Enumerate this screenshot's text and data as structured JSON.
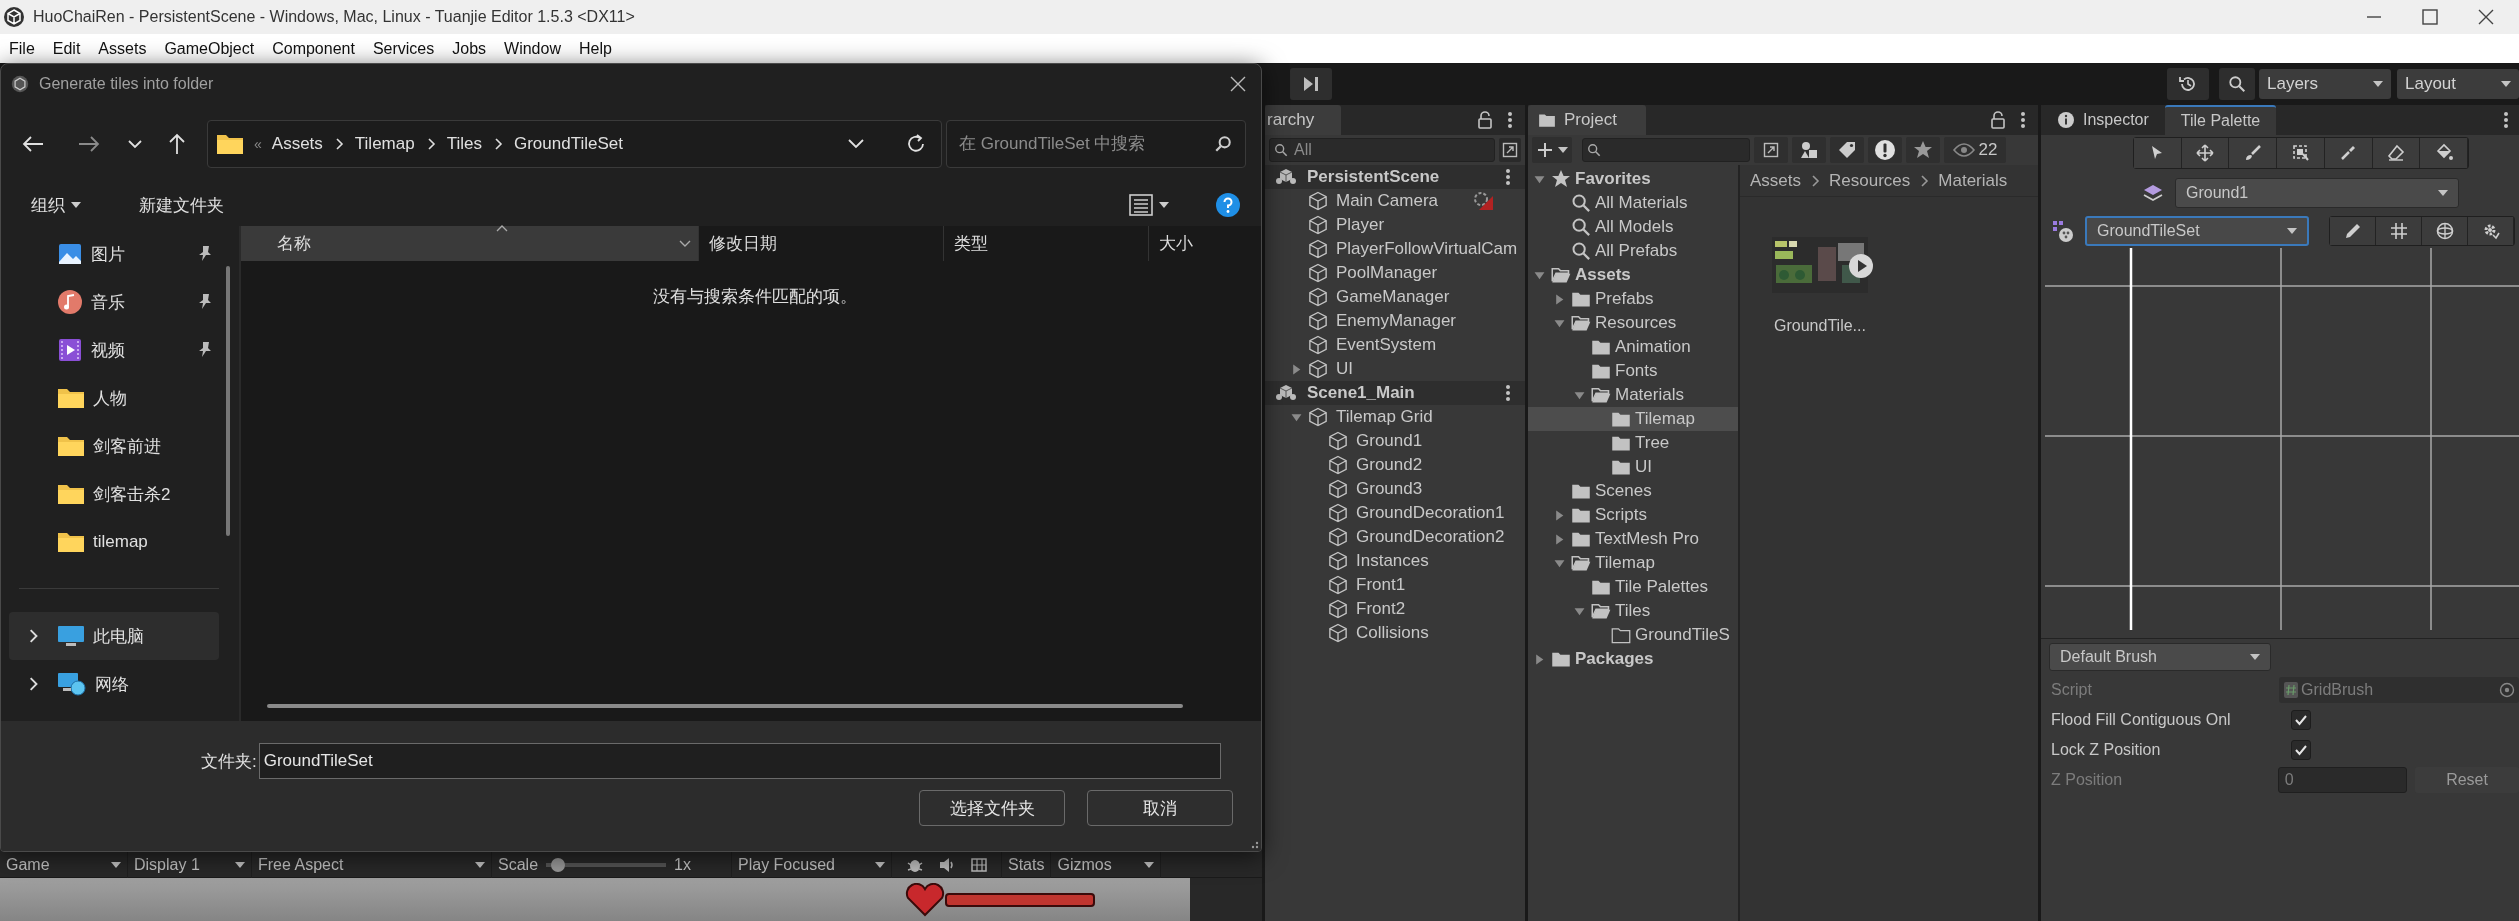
{
  "title_bar": {
    "title": "HuoChaiRen - PersistentScene - Windows, Mac, Linux - Tuanjie Editor 1.5.3 <DX11>"
  },
  "menu_bar": [
    "File",
    "Edit",
    "Assets",
    "GameObject",
    "Component",
    "Services",
    "Jobs",
    "Window",
    "Help"
  ],
  "toolbar": {
    "layers": "Layers",
    "layout": "Layout"
  },
  "dialog": {
    "title": "Generate tiles into folder",
    "overflow_mark": "«",
    "path": [
      "Assets",
      "Tilemap",
      "Tiles",
      "GroundTileSet"
    ],
    "search_placeholder": "在 GroundTileSet 中搜索",
    "commands": [
      "组织",
      "新建文件夹"
    ],
    "nav_items": [
      {
        "label": "图片",
        "kind": "pictures",
        "pinned": true,
        "selected": false
      },
      {
        "label": "音乐",
        "kind": "music",
        "pinned": true,
        "selected": false
      },
      {
        "label": "视频",
        "kind": "videos",
        "pinned": true,
        "selected": false
      },
      {
        "label": "人物",
        "kind": "folder",
        "pinned": false,
        "selected": false
      },
      {
        "label": "剑客前进",
        "kind": "folder",
        "pinned": false,
        "selected": false
      },
      {
        "label": "剑客击杀2",
        "kind": "folder",
        "pinned": false,
        "selected": false
      },
      {
        "label": "tilemap",
        "kind": "folder",
        "pinned": false,
        "selected": false
      },
      {
        "label": "此电脑",
        "kind": "computer",
        "pinned": false,
        "selected": true,
        "expanded": false
      },
      {
        "label": "网络",
        "kind": "network",
        "pinned": false,
        "selected": false,
        "expanded": false
      }
    ],
    "columns": [
      "名称",
      "修改日期",
      "类型",
      "大小"
    ],
    "empty_message": "没有与搜索条件匹配的项。",
    "folder_label": "文件夹:",
    "folder_value": "GroundTileSet",
    "buttons": [
      "选择文件夹",
      "取消"
    ]
  },
  "game_bar": {
    "tab": "Game",
    "display": "Display 1",
    "aspect": "Free Aspect",
    "scale_label": "Scale",
    "scale": {
      "level": 0.05
    },
    "scale_value": "1x",
    "play_mode": "Play Focused",
    "stats": "Stats",
    "gizmos": "Gizmos"
  },
  "hierarchy": {
    "tab": "rarchy",
    "search_placeholder": "All",
    "scenes": [
      {
        "name": "PersistentScene",
        "children": [
          {
            "name": "Main Camera",
            "kind": "camera"
          },
          {
            "name": "Player",
            "kind": "object"
          },
          {
            "name": "PlayerFollowVirtualCam",
            "kind": "object"
          },
          {
            "name": "PoolManager",
            "kind": "object"
          },
          {
            "name": "GameManager",
            "kind": "object"
          },
          {
            "name": "EnemyManager",
            "kind": "object"
          },
          {
            "name": "EventSystem",
            "kind": "object"
          },
          {
            "name": "UI",
            "kind": "object",
            "expanded": false
          }
        ]
      },
      {
        "name": "Scene1_Main",
        "children": [
          {
            "name": "Tilemap Grid",
            "kind": "object",
            "expanded": true,
            "children": [
              {
                "name": "Ground1",
                "kind": "object"
              },
              {
                "name": "Ground2",
                "kind": "object"
              },
              {
                "name": "Ground3",
                "kind": "object"
              },
              {
                "name": "GroundDecoration1",
                "kind": "object"
              },
              {
                "name": "GroundDecoration2",
                "kind": "object"
              },
              {
                "name": "Instances",
                "kind": "object"
              },
              {
                "name": "Front1",
                "kind": "object"
              },
              {
                "name": "Front2",
                "kind": "object"
              },
              {
                "name": "Collisions",
                "kind": "object"
              }
            ]
          }
        ]
      }
    ]
  },
  "project": {
    "tab": "Project",
    "count": "22",
    "tree": [
      {
        "name": "Favorites",
        "kind": "favorites",
        "selected": false,
        "expanded": true,
        "children": [
          {
            "name": "All Materials",
            "kind": "search",
            "selected": false
          },
          {
            "name": "All Models",
            "kind": "search",
            "selected": false
          },
          {
            "name": "All Prefabs",
            "kind": "search",
            "selected": false
          }
        ]
      },
      {
        "name": "Assets",
        "kind": "root",
        "selected": false,
        "expanded": true,
        "children": [
          {
            "name": "Prefabs",
            "kind": "folder",
            "selected": false,
            "expanded": false
          },
          {
            "name": "Resources",
            "kind": "folder",
            "selected": false,
            "expanded": true,
            "children": [
              {
                "name": "Animation",
                "kind": "folder",
                "selected": false
              },
              {
                "name": "Fonts",
                "kind": "folder",
                "selected": false
              },
              {
                "name": "Materials",
                "kind": "folder",
                "selected": false,
                "expanded": true,
                "children": [
                  {
                    "name": "Tilemap",
                    "kind": "folder",
                    "selected": true
                  },
                  {
                    "name": "Tree",
                    "kind": "folder",
                    "selected": false
                  },
                  {
                    "name": "UI",
                    "kind": "folder",
                    "selected": false
                  }
                ]
              }
            ]
          },
          {
            "name": "Scenes",
            "kind": "folder",
            "selected": false
          },
          {
            "name": "Scripts",
            "kind": "folder",
            "selected": false,
            "expanded": false
          },
          {
            "name": "TextMesh Pro",
            "kind": "folder",
            "selected": false,
            "expanded": false
          },
          {
            "name": "Tilemap",
            "kind": "folder",
            "selected": false,
            "expanded": true,
            "children": [
              {
                "name": "Tile Palettes",
                "kind": "folder",
                "selected": false
              },
              {
                "name": "Tiles",
                "kind": "folder",
                "selected": false,
                "expanded": true,
                "children": [
                  {
                    "name": "GroundTileS",
                    "kind": "empty",
                    "selected": false
                  }
                ]
              }
            ]
          }
        ]
      },
      {
        "name": "Packages",
        "kind": "root",
        "selected": false,
        "expanded": false
      }
    ],
    "breadcrumb": [
      "Assets",
      "Resources",
      "Materials"
    ],
    "assets": [
      {
        "name": "GroundTile...",
        "kind": "picture"
      }
    ]
  },
  "inspector": {
    "tabs": [
      {
        "label": "Inspector",
        "selected": false
      },
      {
        "label": "Tile Palette",
        "selected": true
      }
    ],
    "active_layer": "Ground1",
    "palette": "GroundTileSet",
    "brush": "Default Brush",
    "properties": [
      {
        "label": "Script",
        "kind": "object",
        "value": "GridBrush",
        "disabled": true
      },
      {
        "label": "Flood Fill Contiguous Onl",
        "kind": "checkbox",
        "checked": true,
        "disabled": false
      },
      {
        "label": "Lock Z Position",
        "kind": "checkbox",
        "checked": true,
        "disabled": false
      },
      {
        "label": "Z Position",
        "kind": "number",
        "value": "0",
        "button": "Reset",
        "disabled": true
      }
    ]
  }
}
